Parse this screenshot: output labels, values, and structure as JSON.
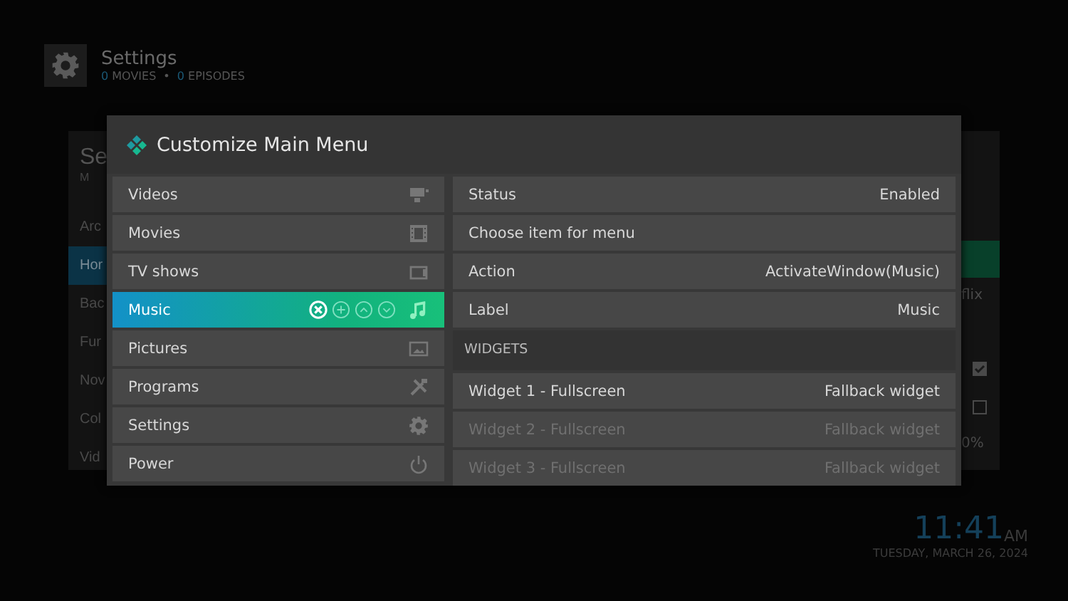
{
  "header": {
    "title": "Settings",
    "counts": [
      {
        "count": "0",
        "label": "MOVIES"
      },
      {
        "count": "0",
        "label": "EPISODES"
      }
    ],
    "separator": "•"
  },
  "background_panel": {
    "title": "Se",
    "subtitle": "M",
    "items": [
      {
        "label": "Arc",
        "selected": false
      },
      {
        "label": "Hor",
        "selected": true
      },
      {
        "label": "Bac",
        "selected": false
      },
      {
        "label": "Fur",
        "selected": false
      },
      {
        "label": "Nov",
        "selected": false
      },
      {
        "label": "Col",
        "selected": false
      },
      {
        "label": "Vid",
        "selected": false
      }
    ],
    "right_column": [
      {
        "kind": "highlight"
      },
      {
        "kind": "text",
        "text": "flix"
      },
      {
        "kind": "checkbox",
        "checked": true
      },
      {
        "kind": "checkbox",
        "checked": false
      },
      {
        "kind": "text",
        "text": "0%"
      }
    ]
  },
  "dialog": {
    "title": "Customize Main Menu",
    "menu_items": [
      {
        "label": "Videos",
        "selected": false
      },
      {
        "label": "Movies",
        "selected": false
      },
      {
        "label": "TV shows",
        "selected": false
      },
      {
        "label": "Music",
        "selected": true
      },
      {
        "label": "Pictures",
        "selected": false
      },
      {
        "label": "Programs",
        "selected": false
      },
      {
        "label": "Settings",
        "selected": false
      },
      {
        "label": "Power",
        "selected": false
      }
    ],
    "properties": [
      {
        "label": "Status",
        "value": "Enabled"
      },
      {
        "label": "Choose item for menu"
      },
      {
        "label": "Action",
        "value": "ActivateWindow(Music)"
      },
      {
        "label": "Label",
        "value": "Music"
      }
    ],
    "widgets_heading": "WIDGETS",
    "widgets": [
      {
        "label": "Widget 1 - Fullscreen",
        "value": "Fallback widget",
        "disabled": false
      },
      {
        "label": "Widget 2 - Fullscreen",
        "value": "Fallback widget",
        "disabled": true
      },
      {
        "label": "Widget 3 - Fullscreen",
        "value": "Fallback widget",
        "disabled": true
      }
    ]
  },
  "clock": {
    "time": "11:41",
    "meridiem": "AM",
    "date": "TUESDAY, MARCH 26, 2024"
  }
}
